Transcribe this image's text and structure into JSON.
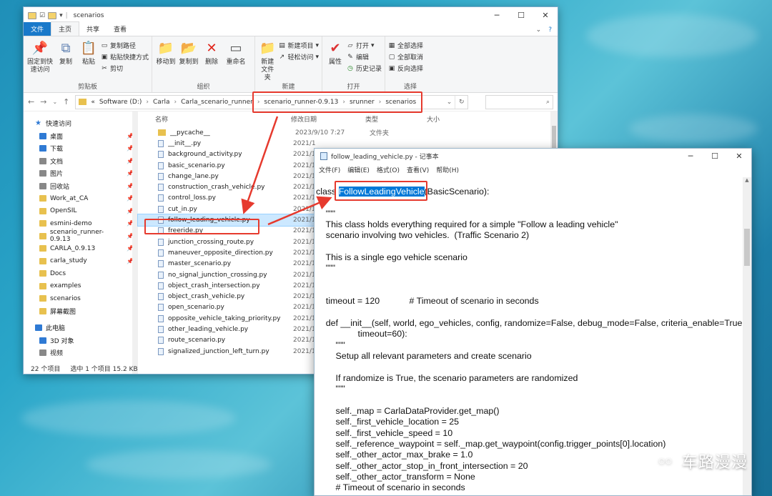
{
  "explorer": {
    "title": "scenarios",
    "tabs": [
      "文件",
      "主页",
      "共享",
      "查看"
    ],
    "ribbon": {
      "clipboard": {
        "pin": "固定到快\n速访问",
        "copy": "复制",
        "paste": "粘贴",
        "copy_path": "复制路径",
        "paste_shortcut": "粘贴快捷方式",
        "cut": "剪切",
        "group": "剪贴板"
      },
      "organize": {
        "move_to": "移动到",
        "copy_to": "复制到",
        "delete": "删除",
        "rename": "重命名",
        "group": "组织"
      },
      "new": {
        "new_item": "新建项目",
        "easy_access": "轻松访问",
        "new_folder": "新建\n文件夹",
        "group": "新建"
      },
      "open": {
        "properties": "属性",
        "open": "打开",
        "edit": "编辑",
        "history": "历史记录",
        "group": "打开"
      },
      "select": {
        "select_all": "全部选择",
        "select_none": "全部取消",
        "invert": "反向选择",
        "group": "选择"
      }
    },
    "address": [
      "«",
      "Software (D:)",
      "Carla",
      "Carla_scenario_runner",
      "scenario_runner-0.9.13",
      "srunner",
      "scenarios"
    ],
    "nav": [
      {
        "label": "快速访问",
        "icon": "star-icon",
        "pin": false,
        "type": "quick"
      },
      {
        "label": "桌面",
        "icon": "desktop-icon",
        "pin": true,
        "type": "blue"
      },
      {
        "label": "下载",
        "icon": "download-icon",
        "pin": true,
        "type": "blue"
      },
      {
        "label": "文档",
        "icon": "document-icon",
        "pin": true,
        "type": "gray"
      },
      {
        "label": "图片",
        "icon": "pictures-icon",
        "pin": true,
        "type": "gray"
      },
      {
        "label": "回收站",
        "icon": "recycle-bin-icon",
        "pin": true,
        "type": "gray"
      },
      {
        "label": "Work_at_CA",
        "icon": "folder-icon",
        "pin": true,
        "type": "folder"
      },
      {
        "label": "OpenSIL",
        "icon": "folder-icon",
        "pin": true,
        "type": "folder"
      },
      {
        "label": "esmini-demo",
        "icon": "folder-icon",
        "pin": true,
        "type": "folder"
      },
      {
        "label": "scenario_runner-0.9.13",
        "icon": "folder-icon",
        "pin": true,
        "type": "folder"
      },
      {
        "label": "CARLA_0.9.13",
        "icon": "folder-icon",
        "pin": true,
        "type": "folder"
      },
      {
        "label": "carla_study",
        "icon": "folder-icon",
        "pin": true,
        "type": "folder"
      },
      {
        "label": "Docs",
        "icon": "folder-icon",
        "pin": false,
        "type": "folder"
      },
      {
        "label": "examples",
        "icon": "folder-icon",
        "pin": false,
        "type": "folder"
      },
      {
        "label": "scenarios",
        "icon": "folder-icon",
        "pin": false,
        "type": "folder"
      },
      {
        "label": "屏幕截图",
        "icon": "folder-icon",
        "pin": false,
        "type": "folder"
      },
      {
        "label": "此电脑",
        "icon": "computer-icon",
        "pin": false,
        "type": "pc"
      },
      {
        "label": "3D 对象",
        "icon": "3d-objects-icon",
        "pin": false,
        "type": "blue"
      },
      {
        "label": "视频",
        "icon": "video-icon",
        "pin": false,
        "type": "gray"
      }
    ],
    "columns": [
      "名称",
      "修改日期",
      "类型",
      "大小"
    ],
    "files": [
      {
        "name": "__pycache__",
        "date": "2023/9/10 7:27",
        "type": "文件夹",
        "folder": true
      },
      {
        "name": "__init__.py",
        "date": "2021/1",
        "type": "",
        "folder": false
      },
      {
        "name": "background_activity.py",
        "date": "2021/1",
        "type": "",
        "folder": false
      },
      {
        "name": "basic_scenario.py",
        "date": "2021/1",
        "type": "",
        "folder": false
      },
      {
        "name": "change_lane.py",
        "date": "2021/1",
        "type": "",
        "folder": false
      },
      {
        "name": "construction_crash_vehicle.py",
        "date": "2021/1",
        "type": "",
        "folder": false
      },
      {
        "name": "control_loss.py",
        "date": "2021/1",
        "type": "",
        "folder": false
      },
      {
        "name": "cut_in.py",
        "date": "2021/1",
        "type": "",
        "folder": false
      },
      {
        "name": "follow_leading_vehicle.py",
        "date": "2021/1",
        "type": "",
        "folder": false,
        "selected": true
      },
      {
        "name": "freeride.py",
        "date": "2021/1",
        "type": "",
        "folder": false
      },
      {
        "name": "junction_crossing_route.py",
        "date": "2021/1",
        "type": "",
        "folder": false
      },
      {
        "name": "maneuver_opposite_direction.py",
        "date": "2021/1",
        "type": "",
        "folder": false
      },
      {
        "name": "master_scenario.py",
        "date": "2021/1",
        "type": "",
        "folder": false
      },
      {
        "name": "no_signal_junction_crossing.py",
        "date": "2021/1",
        "type": "",
        "folder": false
      },
      {
        "name": "object_crash_intersection.py",
        "date": "2021/1",
        "type": "",
        "folder": false
      },
      {
        "name": "object_crash_vehicle.py",
        "date": "2021/1",
        "type": "",
        "folder": false
      },
      {
        "name": "open_scenario.py",
        "date": "2021/1",
        "type": "",
        "folder": false
      },
      {
        "name": "opposite_vehicle_taking_priority.py",
        "date": "2021/1",
        "type": "",
        "folder": false
      },
      {
        "name": "other_leading_vehicle.py",
        "date": "2021/1",
        "type": "",
        "folder": false
      },
      {
        "name": "route_scenario.py",
        "date": "2021/1",
        "type": "",
        "folder": false
      },
      {
        "name": "signalized_junction_left_turn.py",
        "date": "2021/1",
        "type": "",
        "folder": false
      }
    ],
    "status": {
      "count": "22 个项目",
      "selected": "选中 1 个项目  15.2 KB"
    }
  },
  "notepad": {
    "title": "follow_leading_vehicle.py - 记事本",
    "menu": [
      "文件(F)",
      "编辑(E)",
      "格式(O)",
      "查看(V)",
      "帮助(H)"
    ],
    "code_before": "class ",
    "code_highlight": "FollowLeadingVehicle",
    "code_after": "(BasicScenario):\n\n    \"\"\"\n    This class holds everything required for a simple \"Follow a leading vehicle\"\n    scenario involving two vehicles.  (Traffic Scenario 2)\n\n    This is a single ego vehicle scenario\n    \"\"\"\n\n\n    timeout = 120            # Timeout of scenario in seconds\n\n    def __init__(self, world, ego_vehicles, config, randomize=False, debug_mode=False, criteria_enable=True,\n                 timeout=60):\n        \"\"\"\n        Setup all relevant parameters and create scenario\n\n        If randomize is True, the scenario parameters are randomized\n        \"\"\"\n\n        self._map = CarlaDataProvider.get_map()\n        self._first_vehicle_location = 25\n        self._first_vehicle_speed = 10\n        self._reference_waypoint = self._map.get_waypoint(config.trigger_points[0].location)\n        self._other_actor_max_brake = 1.0\n        self._other_actor_stop_in_front_intersection = 20\n        self._other_actor_transform = None\n        # Timeout of scenario in seconds\n        self.timeout = timeout"
  },
  "watermark": "车路漫漫",
  "colors": {
    "accent": "#0078d7",
    "annotation": "#e63a2e",
    "selection": "#cce8ff"
  }
}
